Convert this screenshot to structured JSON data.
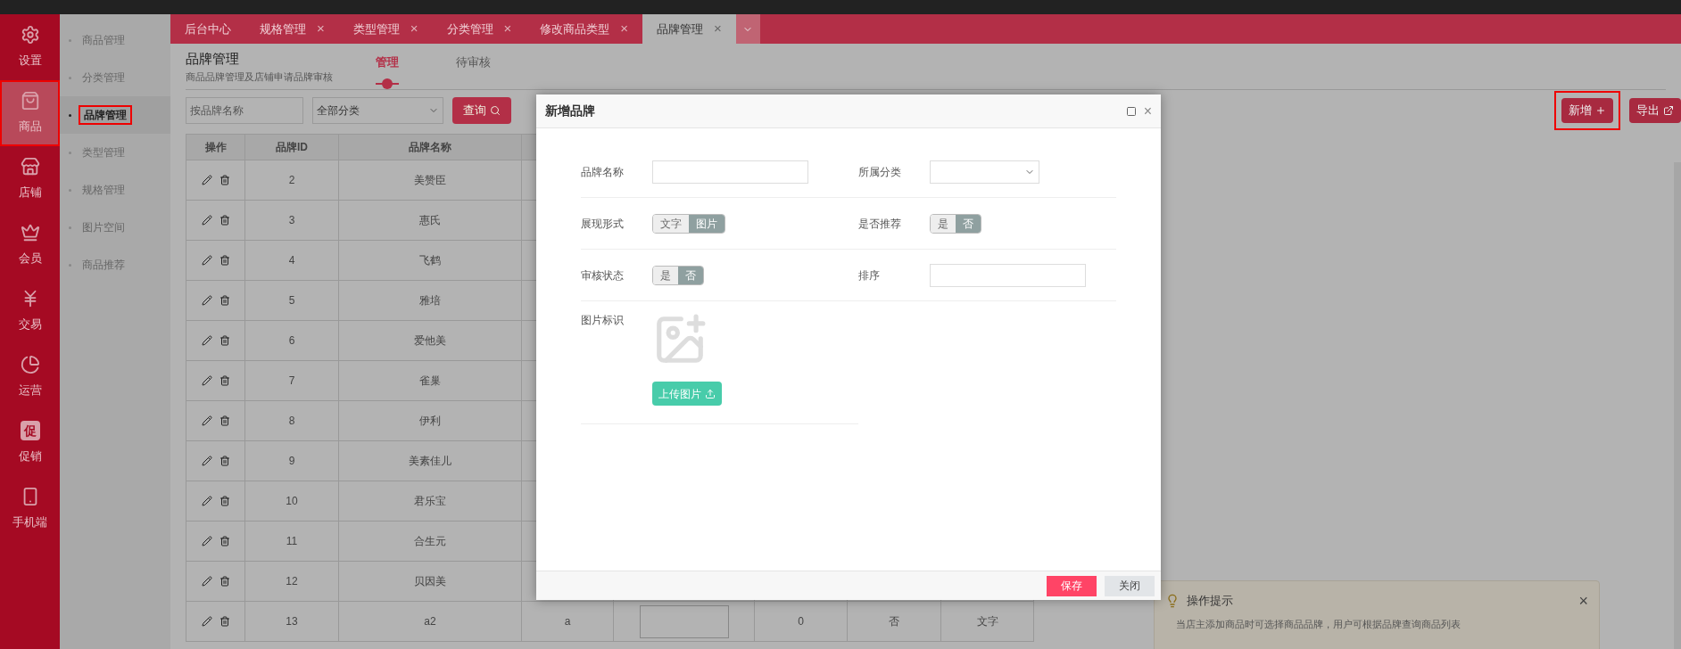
{
  "nav": [
    {
      "kind": "gear",
      "label": "设置",
      "selected": false,
      "highlighted": false
    },
    {
      "kind": "bag",
      "label": "商品",
      "selected": true,
      "highlighted": true
    },
    {
      "kind": "store",
      "label": "店铺",
      "selected": false,
      "highlighted": false
    },
    {
      "kind": "crown",
      "label": "会员",
      "selected": false,
      "highlighted": false
    },
    {
      "kind": "yen",
      "label": "交易",
      "selected": false,
      "highlighted": false
    },
    {
      "kind": "pie",
      "label": "运营",
      "selected": false,
      "highlighted": false
    },
    {
      "kind": "glyph",
      "glyph": "促",
      "label": "促销",
      "selected": false,
      "highlighted": false
    },
    {
      "kind": "phone",
      "label": "手机端",
      "selected": false,
      "highlighted": false
    }
  ],
  "sub_nav": [
    {
      "label": "商品管理",
      "selected": false,
      "highlighted": false
    },
    {
      "label": "分类管理",
      "selected": false,
      "highlighted": false
    },
    {
      "label": "品牌管理",
      "selected": true,
      "highlighted": true
    },
    {
      "label": "类型管理",
      "selected": false,
      "highlighted": false
    },
    {
      "label": "规格管理",
      "selected": false,
      "highlighted": false
    },
    {
      "label": "图片空间",
      "selected": false,
      "highlighted": false
    },
    {
      "label": "商品推荐",
      "selected": false,
      "highlighted": false
    }
  ],
  "tabs": [
    {
      "label": "后台中心",
      "selected": false,
      "closable": false
    },
    {
      "label": "规格管理",
      "selected": false,
      "closable": true
    },
    {
      "label": "类型管理",
      "selected": false,
      "closable": true
    },
    {
      "label": "分类管理",
      "selected": false,
      "closable": true
    },
    {
      "label": "修改商品类型",
      "selected": false,
      "closable": true
    },
    {
      "label": "品牌管理",
      "selected": true,
      "closable": true
    }
  ],
  "tab_close_glyph": "×",
  "page": {
    "title": "品牌管理",
    "subtitle": "商品品牌管理及店铺申请品牌审核",
    "tabs": [
      {
        "label": "管理",
        "selected": true
      },
      {
        "label": "待审核",
        "selected": false
      }
    ]
  },
  "filters": {
    "search_placeholder": "按品牌名称",
    "category": "全部分类",
    "query_button": "查询"
  },
  "actions": {
    "new_button": {
      "label": "新增",
      "highlighted": true
    },
    "export_button": "导出"
  },
  "table": {
    "columns": [
      "操作",
      "品牌ID",
      "品牌名称"
    ],
    "rows": [
      {
        "id": "2",
        "name": "美赞臣"
      },
      {
        "id": "3",
        "name": "惠氏"
      },
      {
        "id": "4",
        "name": "飞鹤"
      },
      {
        "id": "5",
        "name": "雅培"
      },
      {
        "id": "6",
        "name": "爱他美"
      },
      {
        "id": "7",
        "name": "雀巢"
      },
      {
        "id": "8",
        "name": "伊利"
      },
      {
        "id": "9",
        "name": "美素佳儿"
      },
      {
        "id": "10",
        "name": "君乐宝"
      },
      {
        "id": "11",
        "name": "合生元"
      },
      {
        "id": "12",
        "name": "贝因美"
      },
      {
        "id": "13",
        "name": "a2",
        "column_4": "a",
        "column_6": "0",
        "column_7": "否",
        "column_8": "文字"
      }
    ]
  },
  "dialog": {
    "title": "新增品牌",
    "close_glyph": "×",
    "fields": [
      {
        "kind": "text",
        "label": "品牌名称"
      },
      {
        "kind": "select",
        "label": "所属分类"
      },
      {
        "kind": "toggle",
        "label": "展现形式",
        "options": [
          {
            "label": "文字",
            "selected": false
          },
          {
            "label": "图片",
            "selected": true
          }
        ]
      },
      {
        "kind": "toggle",
        "label": "是否推荐",
        "options": [
          {
            "label": "是",
            "selected": false
          },
          {
            "label": "否",
            "selected": true
          }
        ]
      },
      {
        "kind": "toggle",
        "label": "审核状态",
        "options": [
          {
            "label": "是",
            "selected": false
          },
          {
            "label": "否",
            "selected": true
          }
        ]
      },
      {
        "kind": "text",
        "label": "排序"
      },
      {
        "kind": "upload",
        "label": "图片标识",
        "button": "上传图片"
      }
    ],
    "buttons": {
      "save": "保存",
      "close": "关闭"
    }
  },
  "tip": {
    "title": "操作提示",
    "text": "当店主添加商品时可选择商品品牌，用户可根据品牌查询商品列表",
    "close_glyph": "×"
  }
}
